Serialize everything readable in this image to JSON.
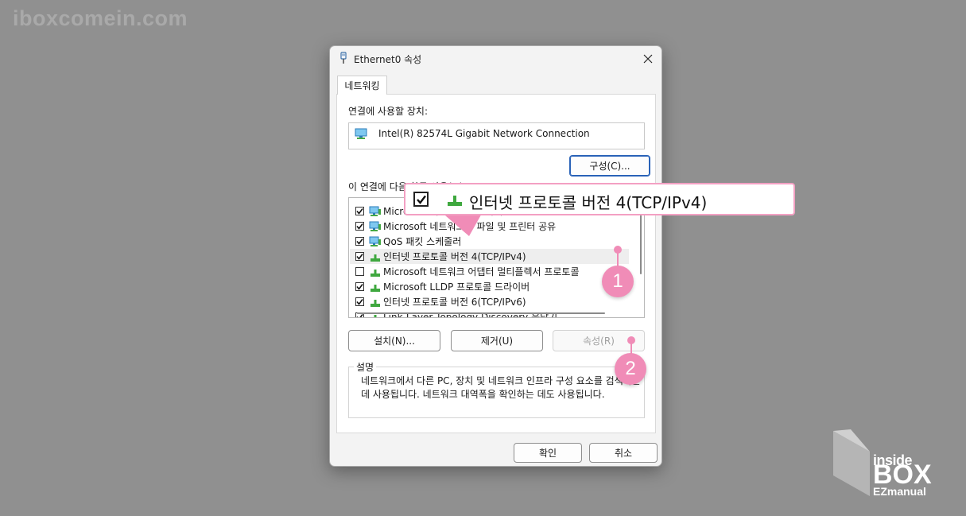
{
  "watermark": "iboxcomein.com",
  "logo": {
    "line1": "inside",
    "line2": "BOX",
    "line3": "EZmanual"
  },
  "dialog": {
    "title": "Ethernet0 속성",
    "tab": "네트워킹",
    "connect_using_label": "연결에 사용할 장치:",
    "device_name": "Intel(R) 82574L Gigabit Network Connection",
    "configure_button": "구성(C)...",
    "items_label": "이 연결에 다음 항목 사용(O):",
    "items": [
      {
        "label": "Microsoft 네트워크용 클라이언트",
        "checked": true,
        "icon": "network-monitor-icon"
      },
      {
        "label": "Microsoft 네트워크용 파일 및 프린터 공유",
        "checked": true,
        "icon": "network-monitor-icon"
      },
      {
        "label": "QoS 패킷 스케줄러",
        "checked": true,
        "icon": "network-monitor-icon"
      },
      {
        "label": "인터넷 프로토콜 버전 4(TCP/IPv4)",
        "checked": true,
        "icon": "protocol-icon",
        "selected": true
      },
      {
        "label": "Microsoft 네트워크 어댑터 멀티플렉서 프로토콜",
        "checked": false,
        "icon": "protocol-icon"
      },
      {
        "label": "Microsoft LLDP 프로토콜 드라이버",
        "checked": true,
        "icon": "protocol-icon"
      },
      {
        "label": "인터넷 프로토콜 버전 6(TCP/IPv6)",
        "checked": true,
        "icon": "protocol-icon"
      },
      {
        "label": "Link-Layer Topology Discovery 응답기",
        "checked": true,
        "icon": "protocol-icon"
      }
    ],
    "install_button": "설치(N)...",
    "uninstall_button": "제거(U)",
    "properties_button": "속성(R)",
    "description_legend": "설명",
    "description_text": "네트워크에서 다른 PC, 장치 및 네트워크 인프라 구성 요소를 검색하는 데 사용됩니다. 네트워크 대역폭을 확인하는 데도 사용됩니다.",
    "ok_button": "확인",
    "cancel_button": "취소"
  },
  "annotation": {
    "callout_text": "인터넷 프로토콜 버전 4(TCP/IPv4)",
    "badge1": "1",
    "badge2": "2",
    "accent_color": "#f08cb7"
  }
}
